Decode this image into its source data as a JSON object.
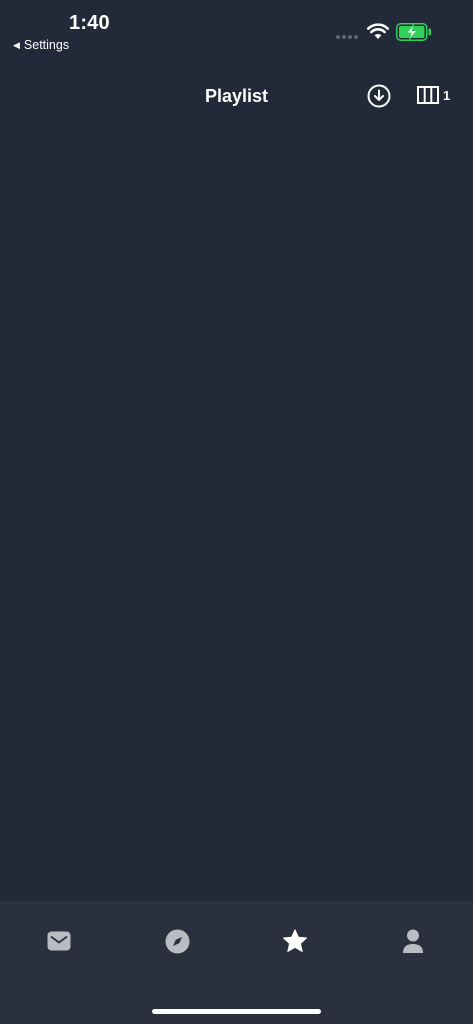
{
  "status_bar": {
    "time": "1:40",
    "back_label": "Settings",
    "wifi_icon": "wifi-icon",
    "battery_icon": "battery-charging-icon",
    "battery_color": "#30d158"
  },
  "nav": {
    "title": "Playlist",
    "download_icon": "download-circle-icon",
    "columns_icon": "columns-icon",
    "columns_count": "1"
  },
  "tab_bar": {
    "tabs": [
      {
        "icon": "mail-icon",
        "selected": false
      },
      {
        "icon": "compass-icon",
        "selected": false
      },
      {
        "icon": "star-icon",
        "selected": true
      },
      {
        "icon": "person-icon",
        "selected": false
      }
    ],
    "active_color": "#ffffff",
    "inactive_color": "#b9bcc3"
  },
  "colors": {
    "background": "#222938",
    "tab_bar_background": "#2a303e"
  }
}
